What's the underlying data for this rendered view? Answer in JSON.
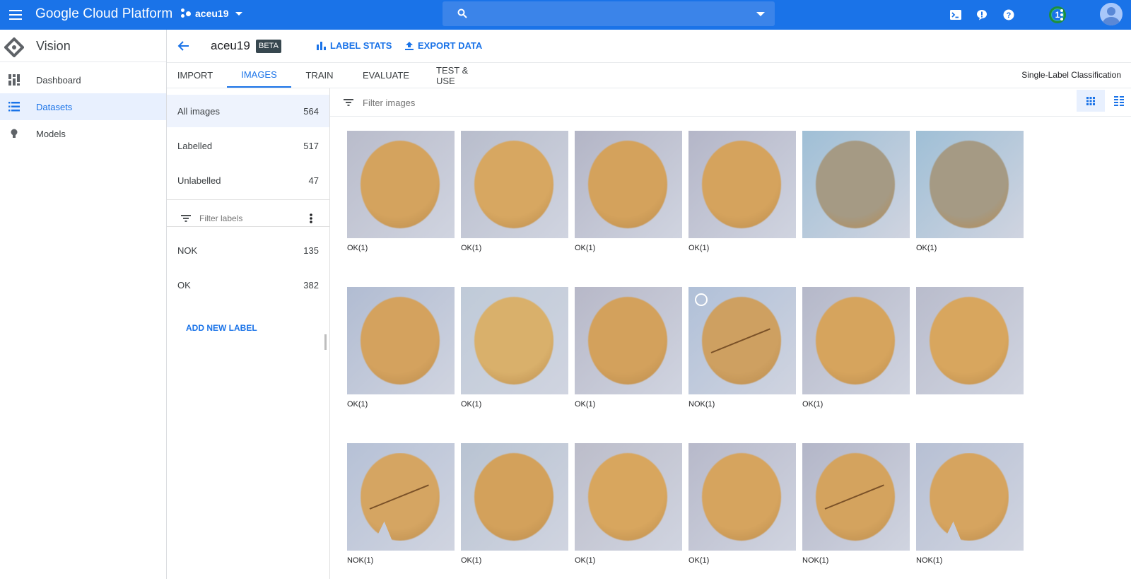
{
  "topbar": {
    "brand": "Google Cloud Platform",
    "project": "aceu19",
    "search_placeholder": "",
    "notification_count": "1",
    "icons": [
      "menu-icon",
      "project-icon",
      "search-icon",
      "cloud-shell-icon",
      "feedback-icon",
      "help-icon",
      "notifications-badge",
      "more-vert-icon",
      "account-avatar"
    ]
  },
  "sidebar": {
    "product": "Vision",
    "items": [
      {
        "label": "Dashboard",
        "icon": "dashboard-icon",
        "active": false
      },
      {
        "label": "Datasets",
        "icon": "list-icon",
        "active": true
      },
      {
        "label": "Models",
        "icon": "lightbulb-icon",
        "active": false
      }
    ]
  },
  "header": {
    "dataset_name": "aceu19",
    "badge": "BETA",
    "actions": [
      {
        "label": "LABEL STATS",
        "icon": "bar-chart-icon"
      },
      {
        "label": "EXPORT DATA",
        "icon": "upload-icon"
      }
    ]
  },
  "tabs": {
    "items": [
      "IMPORT",
      "IMAGES",
      "TRAIN",
      "EVALUATE",
      "TEST & USE"
    ],
    "active": "IMAGES",
    "model_type": "Single-Label Classification"
  },
  "left_panel": {
    "filters": [
      {
        "label": "All images",
        "count": "564",
        "active": true
      },
      {
        "label": "Labelled",
        "count": "517",
        "active": false
      },
      {
        "label": "Unlabelled",
        "count": "47",
        "active": false
      }
    ],
    "filter_labels_placeholder": "Filter labels",
    "labels": [
      {
        "label": "NOK",
        "count": "135"
      },
      {
        "label": "OK",
        "count": "382"
      }
    ],
    "add_label": "ADD NEW LABEL"
  },
  "content": {
    "filter_images_placeholder": "Filter images",
    "view_modes": [
      "grid-view",
      "list-view"
    ],
    "active_view": "grid-view",
    "images": [
      {
        "caption": "OK(1)",
        "bg": "#b9bccb",
        "cookie": "#d4a35e",
        "crack": false,
        "bite": false
      },
      {
        "caption": "OK(1)",
        "bg": "#b8bdcc",
        "cookie": "#d7a761",
        "crack": false,
        "bite": false
      },
      {
        "caption": "OK(1)",
        "bg": "#b3b5c6",
        "cookie": "#d4a25c",
        "crack": false,
        "bite": false
      },
      {
        "caption": "OK(1)",
        "bg": "#b4b6c8",
        "cookie": "#d5a35d",
        "crack": false,
        "bite": false
      },
      {
        "caption": "",
        "bg": "#9fbfd6",
        "cookie": "#a59a84",
        "crack": false,
        "bite": false
      },
      {
        "caption": "OK(1)",
        "bg": "#9fbfd6",
        "cookie": "#a59a84",
        "crack": false,
        "bite": false
      },
      {
        "caption": "OK(1)",
        "bg": "#b1bcd2",
        "cookie": "#d4a25e",
        "crack": false,
        "bite": false
      },
      {
        "caption": "OK(1)",
        "bg": "#bfcad8",
        "cookie": "#d9b06b",
        "crack": false,
        "bite": false
      },
      {
        "caption": "OK(1)",
        "bg": "#b7b8c8",
        "cookie": "#d3a15c",
        "crack": false,
        "bite": false
      },
      {
        "caption": "NOK(1)",
        "bg": "#b0c0d8",
        "cookie": "#cea061",
        "crack": true,
        "bite": false,
        "selected_ring": true
      },
      {
        "caption": "OK(1)",
        "bg": "#b5b8c9",
        "cookie": "#d6a45d",
        "crack": false,
        "bite": false
      },
      {
        "caption": "",
        "bg": "#b9bccc",
        "cookie": "#d8a65e",
        "crack": false,
        "bite": false
      },
      {
        "caption": "NOK(1)",
        "bg": "#b6c1d6",
        "cookie": "#d5a562",
        "crack": true,
        "bite": true
      },
      {
        "caption": "OK(1)",
        "bg": "#b8c3d2",
        "cookie": "#d3a15b",
        "crack": false,
        "bite": false
      },
      {
        "caption": "OK(1)",
        "bg": "#bcbdca",
        "cookie": "#d8a65e",
        "crack": false,
        "bite": false
      },
      {
        "caption": "OK(1)",
        "bg": "#b7b9ca",
        "cookie": "#d6a45e",
        "crack": false,
        "bite": false
      },
      {
        "caption": "NOK(1)",
        "bg": "#b3b6c8",
        "cookie": "#d4a35e",
        "crack": true,
        "bite": false
      },
      {
        "caption": "NOK(1)",
        "bg": "#b7c0d4",
        "cookie": "#d6a45f",
        "crack": false,
        "bite": true
      }
    ]
  },
  "colors": {
    "brand_blue": "#1a73e8",
    "active_bg": "#e8f0fe",
    "beta_badge": "#37474f"
  }
}
